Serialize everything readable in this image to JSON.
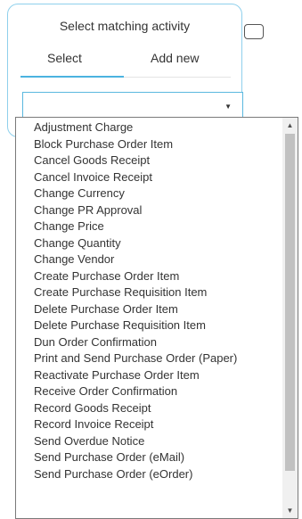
{
  "panel": {
    "title": "Select matching activity",
    "tabs": {
      "select_label": "Select",
      "add_new_label": "Add new",
      "active": "Select"
    }
  },
  "dropdown": {
    "value": "",
    "caret_icon": "chevron-down-icon"
  },
  "activities": [
    "Adjustment Charge",
    "Block Purchase Order Item",
    "Cancel Goods Receipt",
    "Cancel Invoice Receipt",
    "Change Currency",
    "Change PR Approval",
    "Change Price",
    "Change Quantity",
    "Change Vendor",
    "Create Purchase Order Item",
    "Create Purchase Requisition Item",
    "Delete Purchase Order Item",
    "Delete Purchase Requisition Item",
    "Dun Order Confirmation",
    "Print and Send Purchase Order (Paper)",
    "Reactivate Purchase Order Item",
    "Receive Order Confirmation",
    "Record Goods Receipt",
    "Record Invoice Receipt",
    "Send Overdue Notice",
    "Send Purchase Order (eMail)",
    "Send Purchase Order (eOrder)"
  ],
  "colors": {
    "accent": "#4bb3e0",
    "panel_border": "#8fd0ec",
    "scroll_thumb": "#c1c1c1"
  }
}
